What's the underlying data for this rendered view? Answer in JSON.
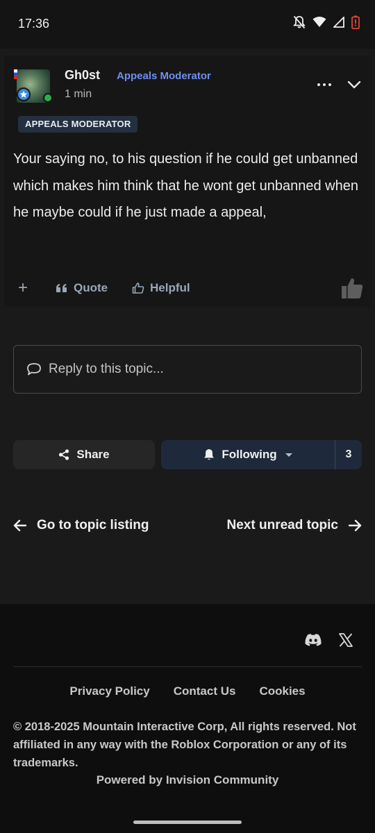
{
  "status_bar": {
    "time": "17:36",
    "icons": [
      "notifications-off-icon",
      "wifi-icon",
      "signal-icon",
      "battery-low-icon"
    ]
  },
  "post": {
    "author": "Gh0st",
    "role": "Appeals Moderator",
    "time_ago": "1 min",
    "badge": "APPEALS MODERATOR",
    "body": "Your saying no, to his question if he could get unbanned which makes him think that he wont get unbanned when he maybe could if he just made a appeal,",
    "actions": {
      "add": "+",
      "quote": "Quote",
      "helpful": "Helpful"
    }
  },
  "reply": {
    "placeholder": "Reply to this topic..."
  },
  "share_label": "Share",
  "follow": {
    "label": "Following",
    "count": "3"
  },
  "nav": {
    "prev": "Go to topic listing",
    "next": "Next unread topic"
  },
  "footer": {
    "links": [
      "Privacy Policy",
      "Contact Us",
      "Cookies"
    ],
    "copyright": "© 2018-2025 Mountain Interactive Corp, All rights reserved. Not affiliated in any way with the Roblox Corporation or any of its trademarks.",
    "powered": "Powered by Invision Community"
  },
  "colors": {
    "role_accent": "#6f8ff2",
    "online": "#27b14a",
    "follow_bg": "#1e2a3b",
    "badge_bg": "#24303f"
  }
}
